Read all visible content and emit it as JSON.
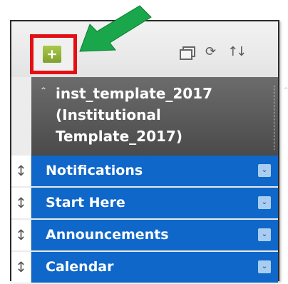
{
  "toolbar": {
    "add_label": "+",
    "icons": [
      "folder-view-icon",
      "refresh-icon",
      "sort-icon"
    ]
  },
  "course": {
    "title_line1": "inst_template_2017",
    "title_line2": "(Institutional",
    "title_line3": "Template_2017)"
  },
  "menu": {
    "items": [
      {
        "label": "Notifications"
      },
      {
        "label": "Start Here"
      },
      {
        "label": "Announcements"
      },
      {
        "label": "Calendar"
      }
    ]
  },
  "colors": {
    "highlight": "#e30f14",
    "arrow": "#1aa64a",
    "menu_blue": "#0f67c9",
    "header_gray": "#5a5a5a",
    "add_green": "#8ab03a"
  }
}
